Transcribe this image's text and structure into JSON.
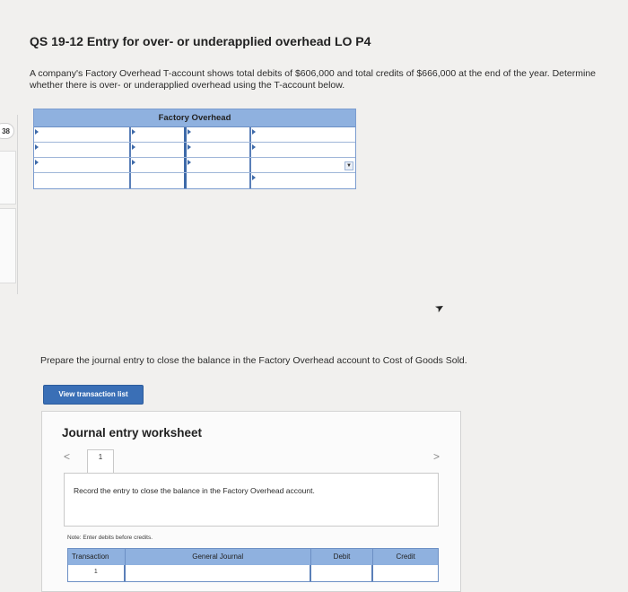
{
  "question": {
    "number_badge": "38",
    "title": "QS 19-12 Entry for over- or underapplied overhead LO P4",
    "prompt": "A company's Factory Overhead T-account shows total debits of $606,000 and total credits of $666,000 at the end of the year. Determine whether there is over- or underapplied overhead using the T-account below."
  },
  "taccount": {
    "title": "Factory Overhead",
    "rows": 4
  },
  "part2": {
    "prompt": "Prepare the journal entry to close the balance in the Factory Overhead account to Cost of Goods Sold.",
    "view_button": "View transaction list"
  },
  "worksheet": {
    "title": "Journal entry worksheet",
    "prev_icon": "<",
    "next_icon": ">",
    "tab_label": "1",
    "instruction": "Record the entry to close the balance in the Factory Overhead account.",
    "note": "Note: Enter debits before credits.",
    "columns": [
      "Transaction",
      "General Journal",
      "Debit",
      "Credit"
    ],
    "first_transaction": "1"
  }
}
